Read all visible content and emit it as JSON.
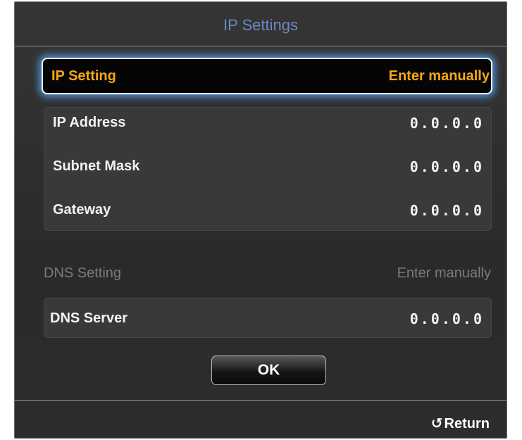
{
  "dialog": {
    "title": "IP Settings"
  },
  "ip_setting": {
    "label": "IP Setting",
    "value": "Enter manually"
  },
  "ip_fields": [
    {
      "label": "IP Address",
      "value": "0.0.0.0"
    },
    {
      "label": "Subnet Mask",
      "value": "0.0.0.0"
    },
    {
      "label": "Gateway",
      "value": "0.0.0.0"
    }
  ],
  "dns_setting": {
    "label": "DNS Setting",
    "value": "Enter manually"
  },
  "dns_server": {
    "label": "DNS Server",
    "value": "0.0.0.0"
  },
  "ok_button": {
    "label": "OK"
  },
  "footer": {
    "return_label": "Return",
    "return_icon": "return-arrow-icon"
  },
  "colors": {
    "title": "#6d86c7",
    "highlight_text": "#f5a816",
    "focus_glow": "#5aaaff",
    "disabled_text": "#7b7b7b"
  }
}
